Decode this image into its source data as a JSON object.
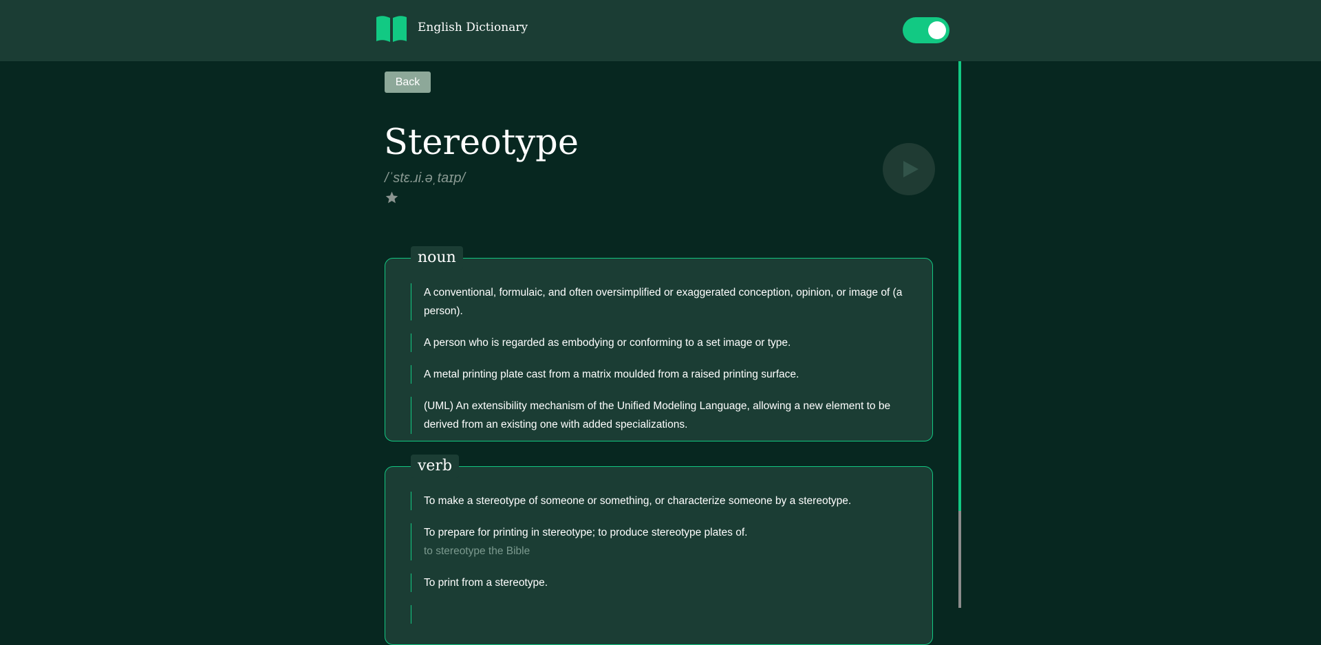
{
  "header": {
    "app_title": "English Dictionary",
    "logo_icon": "open-book-icon",
    "theme_toggle_on": true
  },
  "colors": {
    "accent": "#12c983",
    "background": "#072720",
    "surface": "#1b3d34"
  },
  "back_label": "Back",
  "word": {
    "title": "Stereotype",
    "phonetic": "/ˈstɛ.ɹi.əˌtaɪp/",
    "favorite_icon": "star-icon",
    "play_icon": "play-icon"
  },
  "meanings": [
    {
      "part_of_speech": "noun",
      "definitions": [
        "A conventional, formulaic, and often oversimplified or exaggerated conception, opinion, or image of (a person).",
        "A person who is regarded as embodying or conforming to a set image or type.",
        "A metal printing plate cast from a matrix moulded from a raised printing surface.",
        "(UML) An extensibility mechanism of the Unified Modeling Language, allowing a new element to be derived from an existing one with added specializations."
      ]
    },
    {
      "part_of_speech": "verb",
      "definitions": [
        "To make a stereotype of someone or something, or characterize someone by a stereotype.",
        "To prepare for printing in stereotype; to produce stereotype plates of.",
        "To print from a stereotype."
      ],
      "example": "to stereotype the Bible"
    }
  ]
}
